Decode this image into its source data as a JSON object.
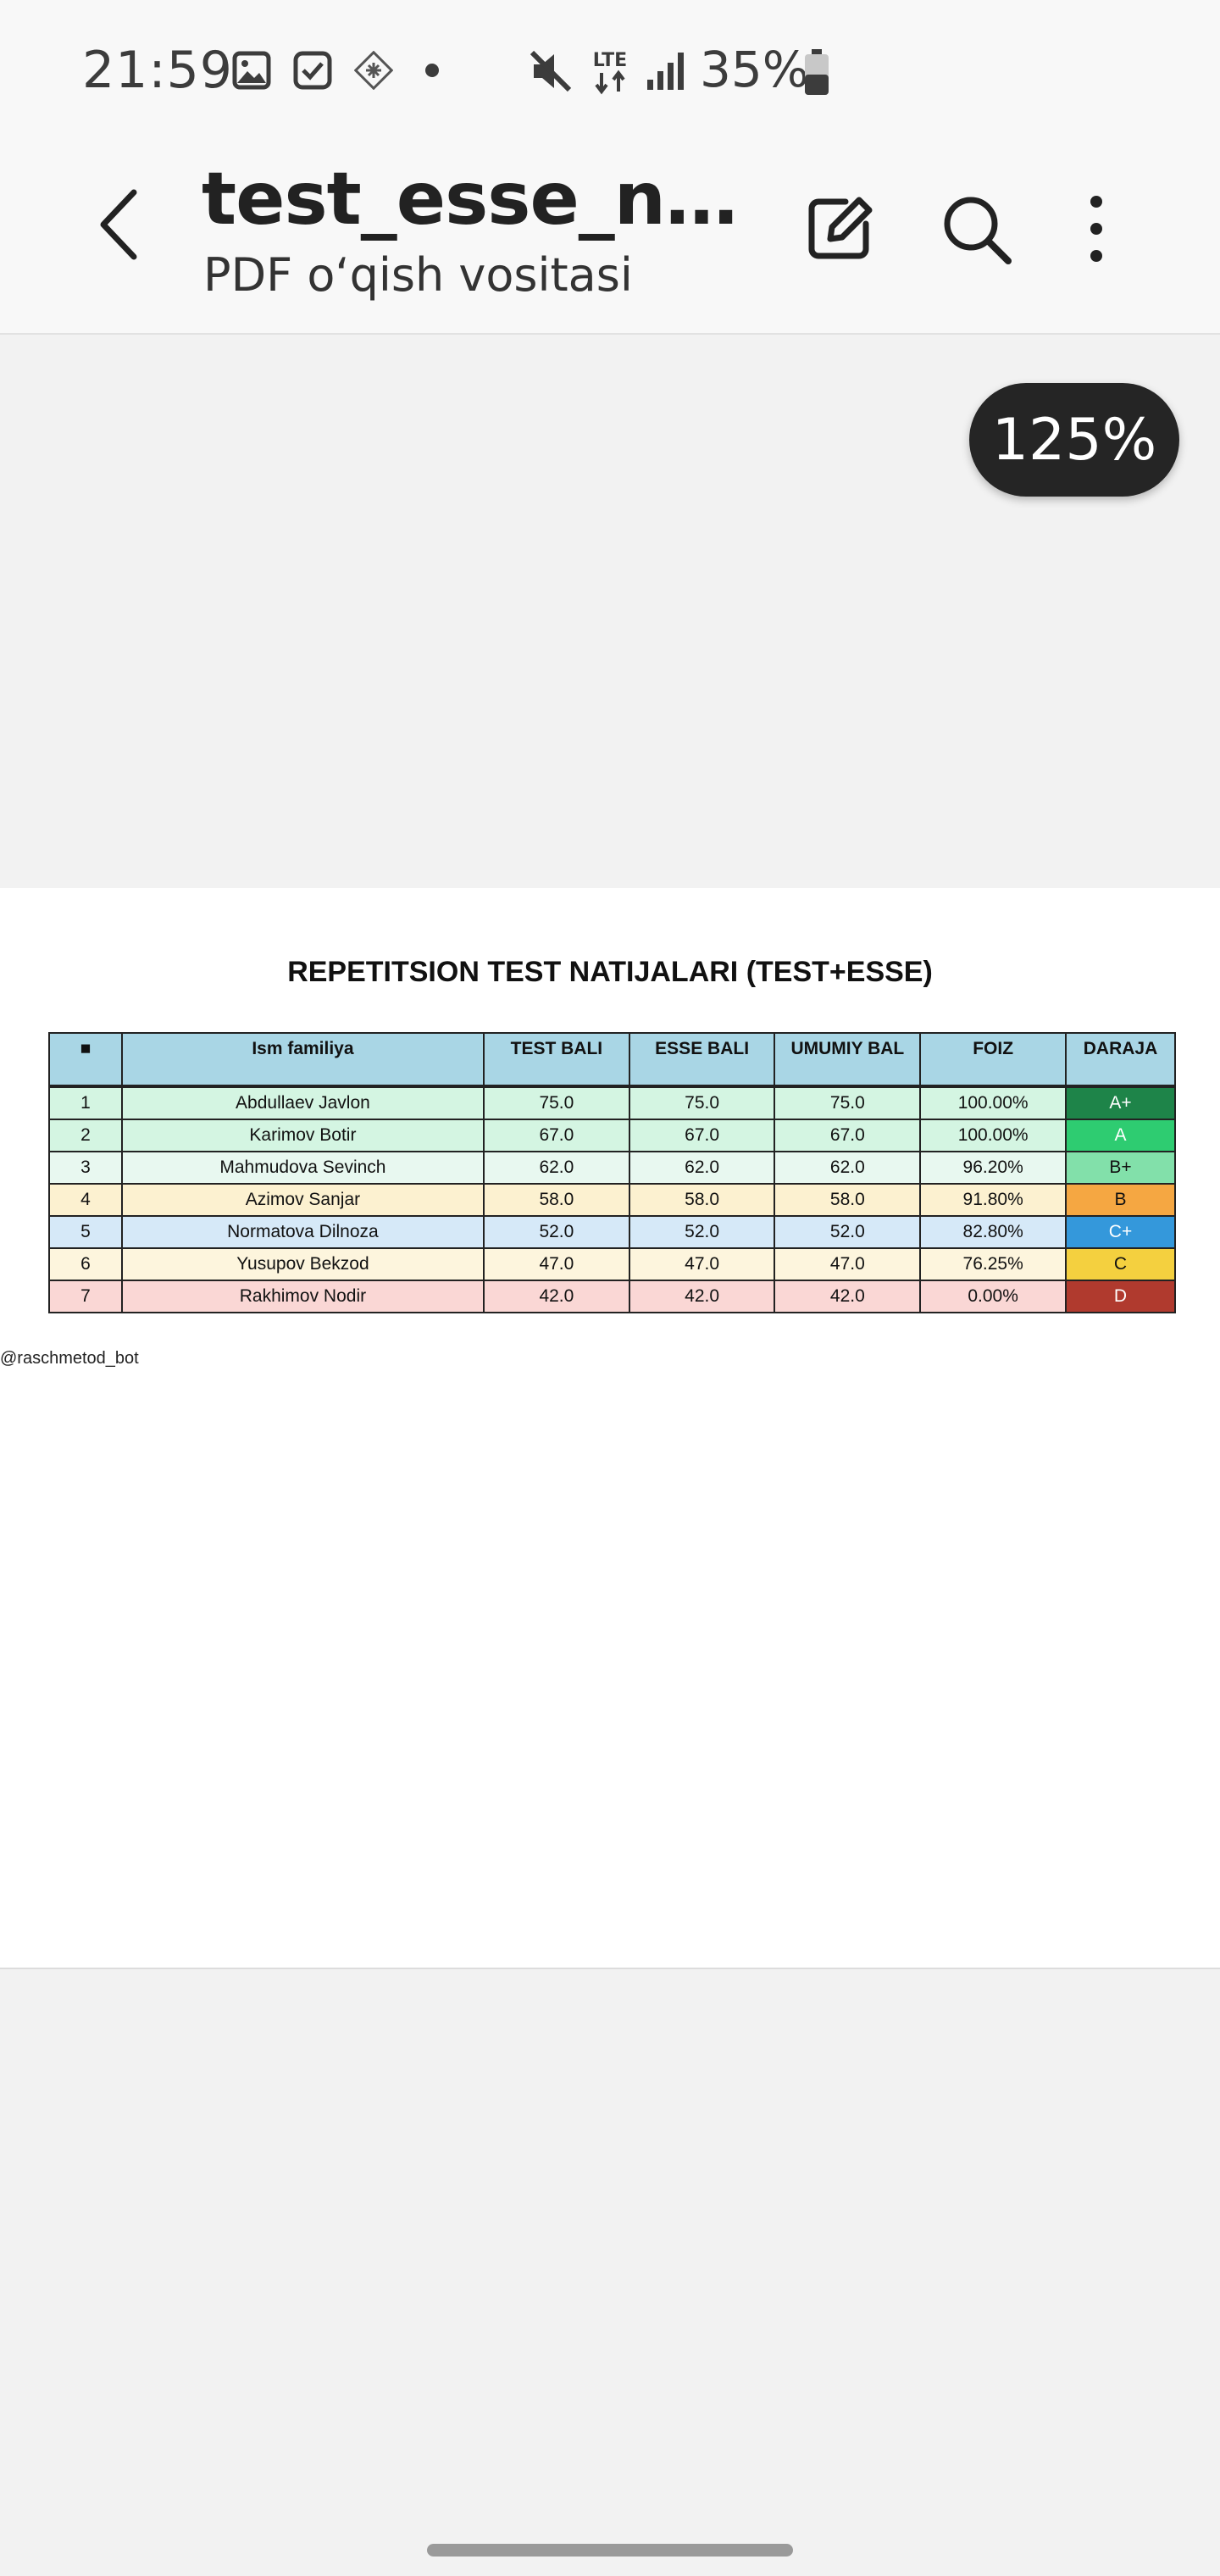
{
  "status_bar": {
    "time": "21:59",
    "network": "LTE",
    "battery_percent": "35%",
    "icons": [
      "image-notification-icon",
      "task-check-icon",
      "app-notification-icon",
      "more-notifications-dot-icon",
      "mute-icon",
      "lte-data-icon",
      "signal-icon",
      "battery-icon"
    ]
  },
  "app_bar": {
    "title": "test_esse_natij…",
    "subtitle": "PDF o‘qish vositasi",
    "actions": [
      "back-icon",
      "edit-icon",
      "search-icon",
      "more-vert-icon"
    ]
  },
  "zoom": {
    "level": "125%"
  },
  "document": {
    "title": "REPETITSION TEST NATIJALARI (TEST+ESSE)",
    "columns": [
      "■",
      "Ism familiya",
      "TEST BALI",
      "ESSE BALI",
      "UMUMIY BAL",
      "FOIZ",
      "DARAJA"
    ],
    "rows": [
      {
        "num": "1",
        "name": "Abdullaev Javlon",
        "test": "75.0",
        "esse": "75.0",
        "total": "75.0",
        "percent": "100.00%",
        "grade": "A+",
        "row_color": "#d4f5e2",
        "grade_color": "#1e8449",
        "grade_text_color": "#ffffff"
      },
      {
        "num": "2",
        "name": "Karimov Botir",
        "test": "67.0",
        "esse": "67.0",
        "total": "67.0",
        "percent": "100.00%",
        "grade": "A",
        "row_color": "#d4f5e2",
        "grade_color": "#2ecc71",
        "grade_text_color": "#ffffff"
      },
      {
        "num": "3",
        "name": "Mahmudova Sevinch",
        "test": "62.0",
        "esse": "62.0",
        "total": "62.0",
        "percent": "96.20%",
        "grade": "B+",
        "row_color": "#e8f8f0",
        "grade_color": "#82e0aa",
        "grade_text_color": "#111111"
      },
      {
        "num": "4",
        "name": "Azimov Sanjar",
        "test": "58.0",
        "esse": "58.0",
        "total": "58.0",
        "percent": "91.80%",
        "grade": "B",
        "row_color": "#fcf1d0",
        "grade_color": "#f5a742",
        "grade_text_color": "#111111"
      },
      {
        "num": "5",
        "name": "Normatova Dilnoza",
        "test": "52.0",
        "esse": "52.0",
        "total": "52.0",
        "percent": "82.80%",
        "grade": "C+",
        "row_color": "#d6e9f8",
        "grade_color": "#3498db",
        "grade_text_color": "#ffffff"
      },
      {
        "num": "6",
        "name": "Yusupov Bekzod",
        "test": "47.0",
        "esse": "47.0",
        "total": "47.0",
        "percent": "76.25%",
        "grade": "C",
        "row_color": "#fdf5dd",
        "grade_color": "#f4d03f",
        "grade_text_color": "#111111"
      },
      {
        "num": "7",
        "name": "Rakhimov Nodir",
        "test": "42.0",
        "esse": "42.0",
        "total": "42.0",
        "percent": "0.00%",
        "grade": "D",
        "row_color": "#fad7d5",
        "grade_color": "#b03a2e",
        "grade_text_color": "#ffffff"
      }
    ],
    "footer": "@raschmetod_bot"
  }
}
